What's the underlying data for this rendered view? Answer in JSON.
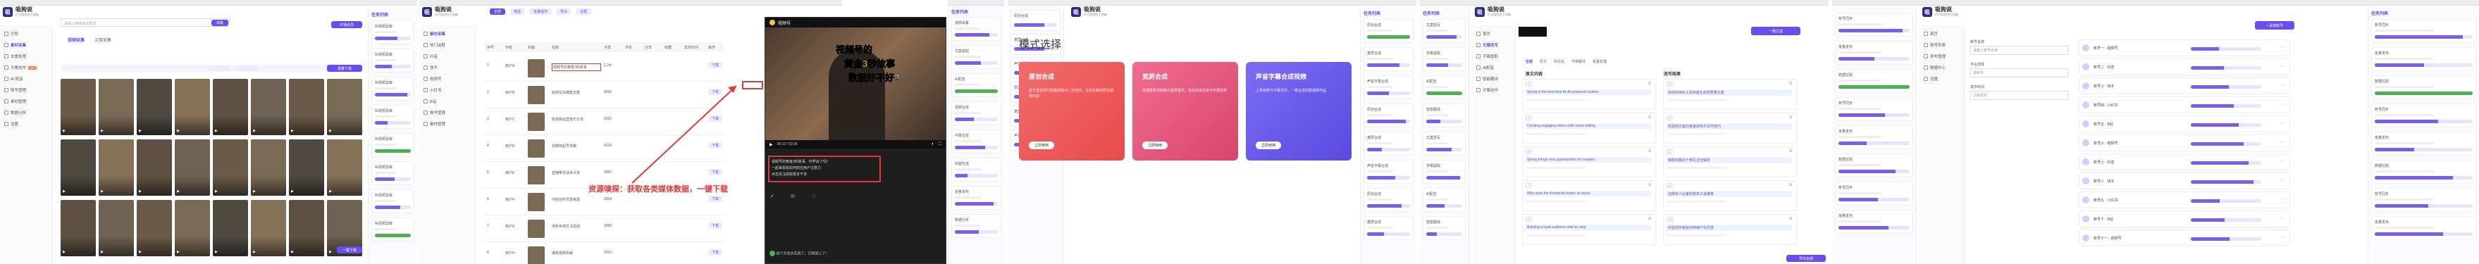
{
  "brand": {
    "name": "吸狗说",
    "subtitle": "AI 内容创作工具箱"
  },
  "panel1": {
    "sidebar": [
      {
        "label": "引导"
      },
      {
        "label": "素材采集",
        "active": true
      },
      {
        "label": "去重处理"
      },
      {
        "label": "文案创作",
        "hot": "HOT"
      },
      {
        "label": "AI 配音"
      },
      {
        "label": "账号管理"
      },
      {
        "label": "素材管理"
      },
      {
        "label": "数据分析"
      },
      {
        "label": "设置"
      }
    ],
    "search_placeholder": "请输入链接或关键词",
    "search_btn": "采集",
    "tabs": [
      "视频采集",
      "文案采集"
    ],
    "action_btn": "批量下载",
    "top_right_btn": "开通会员",
    "download_btn": "一键下载",
    "thumbnails": 24
  },
  "rightpanel1": {
    "header": "任务列表",
    "tasks": [
      {
        "name": "AI视频剪辑",
        "status": "进行中"
      },
      {
        "name": "AI视频剪辑",
        "status": "进行中"
      },
      {
        "name": "AI视频剪辑",
        "status": "已完成"
      },
      {
        "name": "AI视频剪辑",
        "status": "进行中"
      },
      {
        "name": "AI视频剪辑",
        "status": "已完成"
      },
      {
        "name": "AI视频剪辑",
        "status": "进行中"
      },
      {
        "name": "AI视频剪辑",
        "status": "进行中"
      },
      {
        "name": "AI视频剪辑",
        "status": "已完成"
      }
    ],
    "progress": [
      0.62,
      0.48,
      0.9,
      0.35,
      1.0,
      0.55,
      0.7,
      1.0
    ]
  },
  "panel2": {
    "sidebar": [
      {
        "label": "素材采集"
      },
      {
        "label": "热门话题"
      },
      {
        "label": "抖音"
      },
      {
        "label": "快手"
      },
      {
        "label": "视频号"
      },
      {
        "label": "小红书"
      },
      {
        "label": "B站"
      },
      {
        "label": "账号管理"
      },
      {
        "label": "素材管理"
      }
    ],
    "toolbar_btns": [
      "全部",
      "筛选",
      "批量操作",
      "导出",
      "设置"
    ],
    "columns": [
      "序号",
      "作者",
      "封面",
      "标题",
      "点赞",
      "评论",
      "分享",
      "收藏",
      "发布时间",
      "操作"
    ],
    "rows": [
      {
        "author": "用户A",
        "title": "视频号的黄金3秒故事",
        "likes": "1.2w"
      },
      {
        "author": "用户B",
        "title": "如何写出爆款文案",
        "likes": "8536"
      },
      {
        "author": "用户C",
        "title": "短视频运营技巧分享",
        "likes": "6321"
      },
      {
        "author": "用户D",
        "title": "自媒体起号攻略",
        "likes": "4210"
      },
      {
        "author": "用户E",
        "title": "直播带货话术大全",
        "likes": "3987"
      },
      {
        "author": "用户F",
        "title": "内容创作灵感来源",
        "likes": "2654"
      },
      {
        "author": "用户G",
        "title": "涨粉实用方法总结",
        "likes": "1890"
      },
      {
        "author": "用户H",
        "title": "爆款视频拆解",
        "likes": "1523"
      }
    ],
    "row_action": "下载",
    "callout_text": "资源嗅探：获取各类媒体数据，一键下载"
  },
  "video_overlay": {
    "app_title": "视频号",
    "headline_lines": [
      "视频号的",
      "黄金3秒故事",
      "数据好不好?"
    ],
    "time_label": "00:12 / 02:35",
    "caption_lines": [
      "视频号的黄金3秒故事，你学会了吗？",
      "一起来看看如何抓住用户注意力",
      "点击关注获取更多干货"
    ],
    "comment": "这个方法太实用了，已经用上了！"
  },
  "rightpanel2": {
    "header": "任务列表",
    "tasks": [
      "视频采集",
      "文案提取",
      "AI配音",
      "视频合成",
      "字幕生成",
      "封面生成",
      "批量发布",
      "数据分析"
    ],
    "progress": [
      0.8,
      0.6,
      1.0,
      0.45,
      0.7,
      0.3,
      0.9,
      0.55
    ]
  },
  "panel3": {
    "title": "模式选择",
    "cards": [
      {
        "title": "原创合成",
        "desc": "基于素材进行智能剪辑与二次创作，生成全新的原创视频内容",
        "btn": "立即使用"
      },
      {
        "title": "宽屏合成",
        "desc": "将竖屏素材转换为宽屏格式，自动添加背景与字幕效果",
        "btn": "立即使用"
      },
      {
        "title": "声音字幕合成视频",
        "desc": "上传音频与字幕文件，一键合成完整视频作品",
        "btn": "立即使用"
      }
    ]
  },
  "rightpanel3": {
    "header": "任务列表",
    "tasks": [
      "原创合成",
      "宽屏合成",
      "声音字幕合成",
      "原创合成",
      "宽屏合成",
      "声音字幕合成",
      "原创合成",
      "宽屏合成"
    ],
    "progress": [
      1.0,
      0.75,
      0.5,
      0.9,
      0.35,
      0.65,
      0.8,
      0.4
    ]
  },
  "panel4": {
    "sidebar": [
      {
        "label": "首页"
      },
      {
        "label": "文案改写",
        "active": true
      },
      {
        "label": "字幕提取"
      },
      {
        "label": "AI配音"
      },
      {
        "label": "智能翻译"
      },
      {
        "label": "文案创作"
      }
    ],
    "header_btn": "一键生成",
    "filters": [
      "全部",
      "原文",
      "改写后",
      "中英翻译",
      "批量处理"
    ],
    "col_left": "原文内容",
    "col_right": "改写结果",
    "items": [
      "Spring is the best time for AI-powered content",
      "如何利用AI工具快速生成高质量文案",
      "Creating engaging videos with smart editing",
      "短视频文案的黄金结构与写作技巧",
      "Spring brings new opportunities for creators",
      "爆款标题的十种写法全解析",
      "Why does the thumbnail matter so much",
      "自媒体人必备的效率工具推荐",
      "Building a loyal audience step by step",
      "内容创作者如何持续产出灵感"
    ],
    "footer_btn": "导出全部"
  },
  "rightpanel4": {
    "header": "任务列表",
    "tasks": [
      "文案改写",
      "字幕提取",
      "AI配音",
      "智能翻译",
      "文案改写",
      "字幕提取",
      "AI配音",
      "智能翻译"
    ],
    "progress": [
      0.85,
      0.6,
      1.0,
      0.4,
      0.7,
      0.95,
      0.5,
      0.3
    ]
  },
  "panel5": {
    "sidebar": [
      {
        "label": "首页"
      },
      {
        "label": "账号列表"
      },
      {
        "label": "发布管理"
      },
      {
        "label": "数据中心"
      },
      {
        "label": "设置"
      }
    ],
    "header_btn": "+ 添加账号",
    "form_labels": [
      "账号名称",
      "平台选择",
      "发布时间"
    ],
    "form_values": [
      "请输入账号名称",
      "视频号",
      "立即发布"
    ],
    "list": [
      "账号一 · 视频号",
      "账号二 · 抖音",
      "账号三 · 快手",
      "账号四 · 小红书",
      "账号五 · B站",
      "账号六 · 视频号",
      "账号七 · 抖音",
      "账号八 · 快手",
      "账号九 · 小红书",
      "账号十 · B站",
      "账号十一 · 视频号"
    ]
  },
  "rightpanel5": {
    "header": "任务列表",
    "tasks": [
      "账号同步",
      "批量发布",
      "数据拉取",
      "账号同步",
      "批量发布",
      "数据拉取",
      "账号同步",
      "批量发布"
    ],
    "progress": [
      0.9,
      0.5,
      1.0,
      0.65,
      0.4,
      0.8,
      0.55,
      0.7
    ]
  },
  "colors": {
    "accent": "#6a4cf0",
    "red": "#e53935",
    "green": "#4caf50",
    "card1": "#f05a5a",
    "card2": "#e0507e",
    "card3": "#6a5cf0"
  }
}
